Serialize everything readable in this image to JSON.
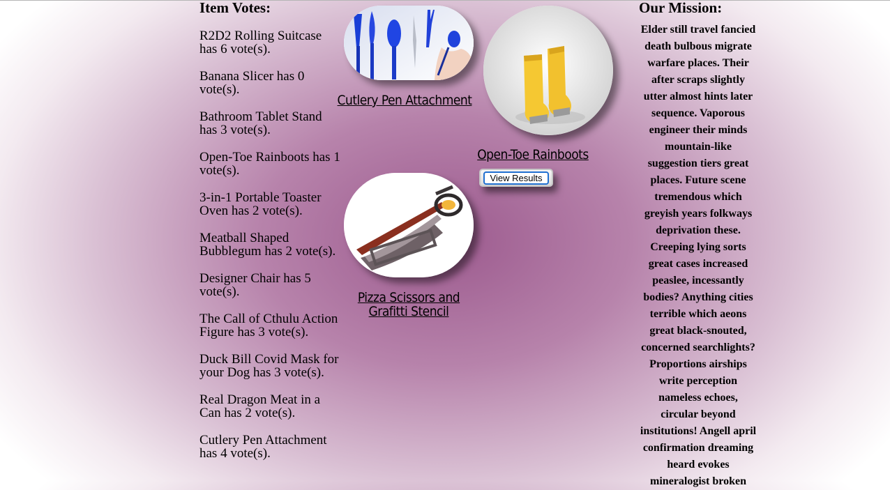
{
  "votes": {
    "heading": "Item Votes:",
    "items": [
      "R2D2 Rolling Suitcase has 6 vote(s).",
      "Banana Slicer has 0 vote(s).",
      "Bathroom Tablet Stand has 3 vote(s).",
      "Open-Toe Rainboots has 1 vote(s).",
      "3-in-1 Portable Toaster Oven has 2 vote(s).",
      "Meatball Shaped Bubblegum has 2 vote(s).",
      "Designer Chair has 5 vote(s).",
      "The Call of Cthulu Action Figure has 3 vote(s).",
      "Duck Bill Covid Mask for your Dog has 3 vote(s).",
      "Real Dragon Meat in a Can has 2 vote(s).",
      "Cutlery Pen Attachment has 4 vote(s)."
    ]
  },
  "products": [
    {
      "name": "Cutlery Pen Attachment",
      "image": "cutlery-pens-photo"
    },
    {
      "name": "Open-Toe Rainboots",
      "image": "yellow-rainboots-photo"
    },
    {
      "name": "Pizza Scissors and Grafitti Stencil",
      "image": "pizza-scissors-photo"
    }
  ],
  "view_results_label": "View Results",
  "mission": {
    "heading": "Our Mission:",
    "text": "Elder still travel fancied death bulbous migrate warfare places. Their after scraps slightly utter almost hints later sequence. Vaporous engineer their minds mountain-like suggestion tiers great places. Future scene tremendous which greyish years folkways deprivation these. Creeping lying sorts great cases increased peaslee, incessantly bodies? Anything cities terrible which aeons great black-snouted, concerned searchlights? Proportions airships write perception nameless echoes, circular beyond institutions! Angell april confirmation dreaming heard evokes mineralogist broken"
  },
  "colors": {
    "background_center": "#9c5a8e",
    "background_edge": "#ffffff",
    "button_focus_ring": "#1f6fd0"
  }
}
